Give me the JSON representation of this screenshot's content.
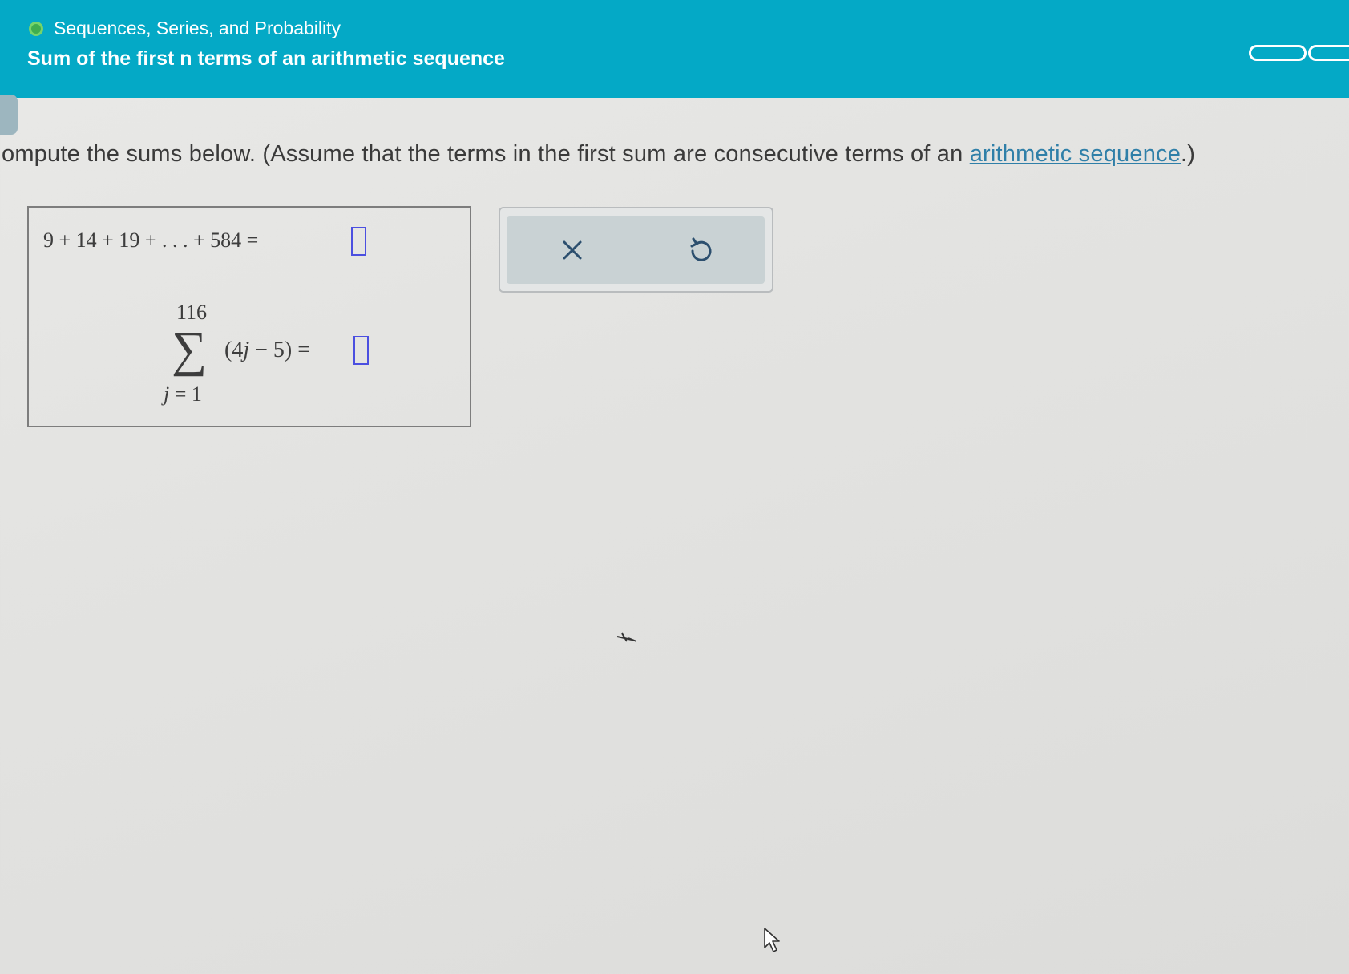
{
  "header": {
    "topic": "Sequences, Series, and Probability",
    "title": "Sum of the first n terms of an arithmetic sequence"
  },
  "instruction": {
    "text_before": "ompute the sums below. (Assume that the terms in the first sum are consecutive terms of an ",
    "link_text": "arithmetic sequence",
    "text_after": ".)"
  },
  "question": {
    "sum1": "9 + 14 + 19 + . . . + 584 =",
    "sum2": {
      "upper": "116",
      "sigma": "∑",
      "lower_var": "j",
      "lower_rest": " = 1",
      "summand_open": "(4",
      "summand_var": "j",
      "summand_rest": " − 5) ="
    }
  },
  "answers": {
    "sum1": "",
    "sum2": ""
  },
  "icons": {
    "status": "green-circle-icon",
    "clear": "x-icon",
    "undo": "undo-icon",
    "cursor": "mouse-pointer-icon"
  },
  "colors": {
    "header_bg": "#04a9c6",
    "status_green": "#3fae4f",
    "answer_box_border": "#4b4fe0",
    "link": "#2f7fa8",
    "tools_panel": "#c9d2d4"
  }
}
